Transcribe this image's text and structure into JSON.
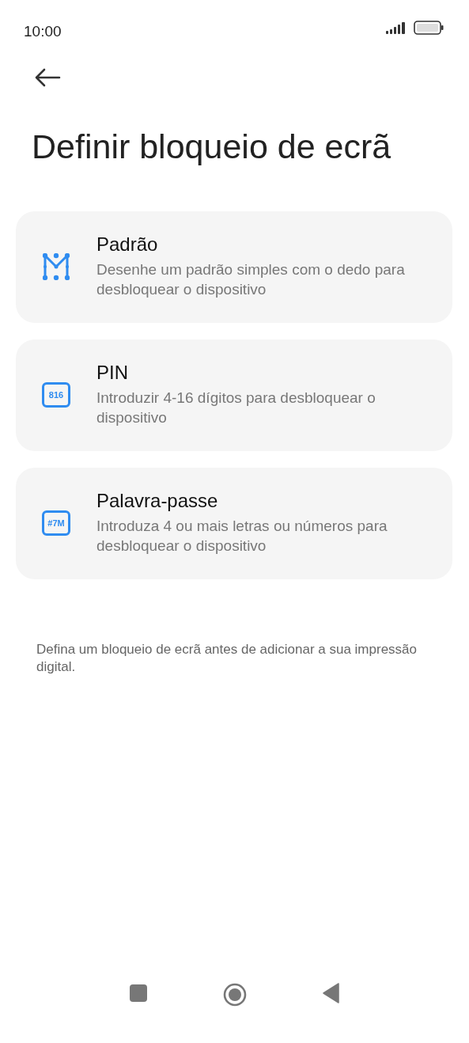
{
  "status_bar": {
    "time": "10:00"
  },
  "title": "Definir bloqueio de ecrã",
  "options": [
    {
      "kind": "pattern",
      "title": "Padrão",
      "description": "Desenhe um padrão simples com o dedo para desbloquear o dispositivo"
    },
    {
      "kind": "pin",
      "icon_text": "816",
      "title": "PIN",
      "description": "Introduzir 4-16 dígitos para desbloquear o dispositivo"
    },
    {
      "kind": "password",
      "icon_text": "#7M",
      "title": "Palavra-passe",
      "description": "Introduza 4 ou mais letras ou números para desbloquear o dispositivo"
    }
  ],
  "footer_note": "Defina um bloqueio de ecrã antes de adicionar a sua impressão digital."
}
